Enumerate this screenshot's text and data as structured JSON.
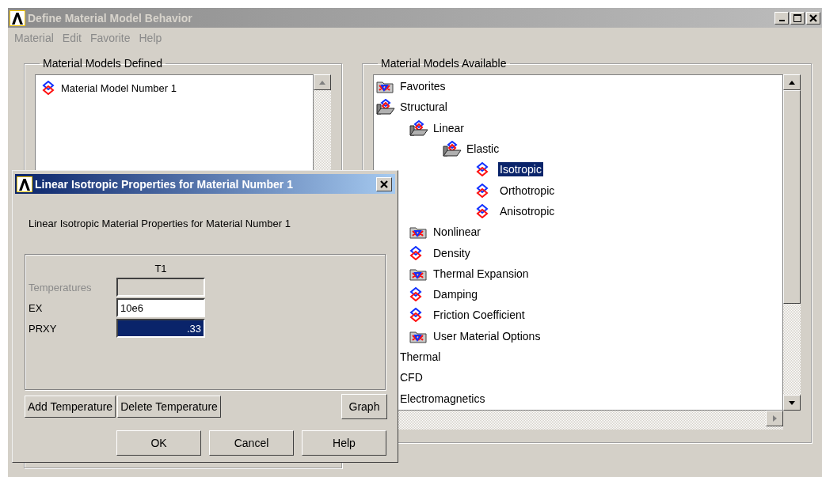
{
  "window": {
    "title": "Define Material Model Behavior"
  },
  "menu": [
    "Material",
    "Edit",
    "Favorite",
    "Help"
  ],
  "defined_panel": {
    "title": "Material Models Defined",
    "items": [
      {
        "label": "Material Model Number 1",
        "selected": false
      }
    ]
  },
  "available_panel": {
    "title": "Material Models Available",
    "tree": [
      {
        "label": "Favorites",
        "kind": "folder",
        "selected": false
      },
      {
        "label": "Structural",
        "kind": "open-folder",
        "selected": false,
        "children": [
          {
            "label": "Linear",
            "kind": "open-folder",
            "selected": false,
            "children": [
              {
                "label": "Elastic",
                "kind": "open-folder",
                "selected": false,
                "children": [
                  {
                    "label": "Isotropic",
                    "kind": "model",
                    "selected": true
                  },
                  {
                    "label": "Orthotropic",
                    "kind": "model",
                    "selected": false
                  },
                  {
                    "label": "Anisotropic",
                    "kind": "model",
                    "selected": false
                  }
                ]
              }
            ]
          },
          {
            "label": "Nonlinear",
            "kind": "folder",
            "selected": false
          },
          {
            "label": "Density",
            "kind": "model",
            "selected": false
          },
          {
            "label": "Thermal Expansion",
            "kind": "folder",
            "selected": false
          },
          {
            "label": "Damping",
            "kind": "model",
            "selected": false
          },
          {
            "label": "Friction Coefficient",
            "kind": "model",
            "selected": false
          },
          {
            "label": "User Material Options",
            "kind": "folder",
            "selected": false
          }
        ]
      },
      {
        "label": "Thermal",
        "kind": "hidden",
        "selected": false
      },
      {
        "label": "CFD",
        "kind": "hidden",
        "selected": false
      },
      {
        "label": "Electromagnetics",
        "kind": "hidden",
        "selected": false
      }
    ]
  },
  "dialog": {
    "title": "Linear Isotropic Properties for Material Number 1",
    "heading": "Linear Isotropic Material Properties for Material Number 1",
    "column": "T1",
    "fields": [
      {
        "label": "Temperatures",
        "disabled": true,
        "selected": false
      },
      {
        "label": "EX",
        "value": "10e6",
        "disabled": false,
        "selected": false
      },
      {
        "label": "PRXY",
        "value": ".33",
        "disabled": false,
        "selected": true
      }
    ],
    "row_buttons": [
      "Add Temperature",
      "Delete Temperature"
    ],
    "graph_button": "Graph",
    "buttons": [
      "OK",
      "Cancel",
      "Help"
    ]
  }
}
